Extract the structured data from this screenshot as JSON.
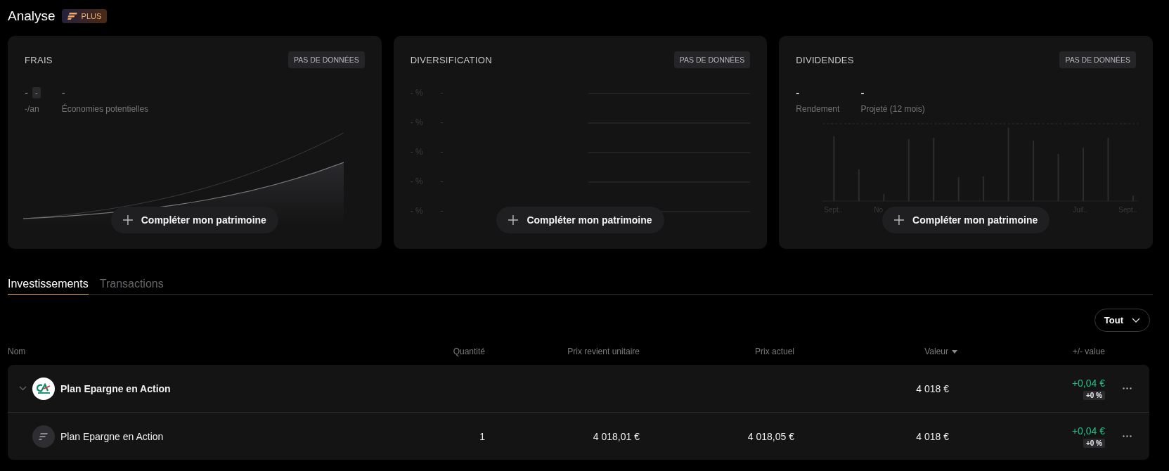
{
  "page": {
    "title": "Analyse",
    "badge": "PLUS"
  },
  "cards": [
    {
      "kind": "fees",
      "title": "FRAIS",
      "status": "PAS DE DONNÉES",
      "value": "-",
      "value_badge": "-",
      "value_caption": "-/an",
      "savings": "-",
      "savings_caption": "Économies potentielles",
      "action": "Compléter mon patrimoine"
    },
    {
      "kind": "diversification",
      "title": "DIVERSIFICATION",
      "status": "PAS DE DONNÉES",
      "rows": [
        {
          "percent": "- %",
          "name": "-"
        },
        {
          "percent": "- %",
          "name": "-"
        },
        {
          "percent": "- %",
          "name": "-"
        },
        {
          "percent": "- %",
          "name": "-"
        },
        {
          "percent": "- %",
          "name": "-"
        }
      ],
      "action": "Compléter mon patrimoine"
    },
    {
      "kind": "dividends",
      "title": "DIVIDENDES",
      "status": "PAS DE DONNÉES",
      "stats": [
        {
          "value": "-",
          "label": "Rendement"
        },
        {
          "value": "-",
          "label": "Projeté (12 mois)"
        }
      ],
      "axis_labels": [
        "Sept..",
        "No",
        "Juil..",
        "Sept.."
      ],
      "action": "Compléter mon patrimoine"
    }
  ],
  "tabs": [
    {
      "label": "Investissements",
      "selected": true
    },
    {
      "label": "Transactions",
      "selected": false
    }
  ],
  "filter": {
    "label": "Tout"
  },
  "table": {
    "columns": [
      {
        "label": "Nom",
        "sorted": false
      },
      {
        "label": "Quantité",
        "sorted": false
      },
      {
        "label": "Prix revient unitaire",
        "sorted": false
      },
      {
        "label": "Prix actuel",
        "sorted": false
      },
      {
        "label": "Valeur",
        "sorted": true
      },
      {
        "label": "+/- value",
        "sorted": false
      }
    ],
    "rows": [
      {
        "kind": "bank",
        "name": "Plan Epargne en Action",
        "expanded": true,
        "value": "4 018 €",
        "gain": "+0,04 €",
        "gain_pct": "+0 %",
        "children": [
          {
            "kind": "platform",
            "name": "Plan Epargne en Action",
            "quantity": "1",
            "unit_cost": "4 018,01 €",
            "price": "4 018,05 €",
            "value": "4 018 €",
            "gain": "+0,04 €",
            "gain_pct": "+0 %"
          }
        ]
      }
    ]
  }
}
